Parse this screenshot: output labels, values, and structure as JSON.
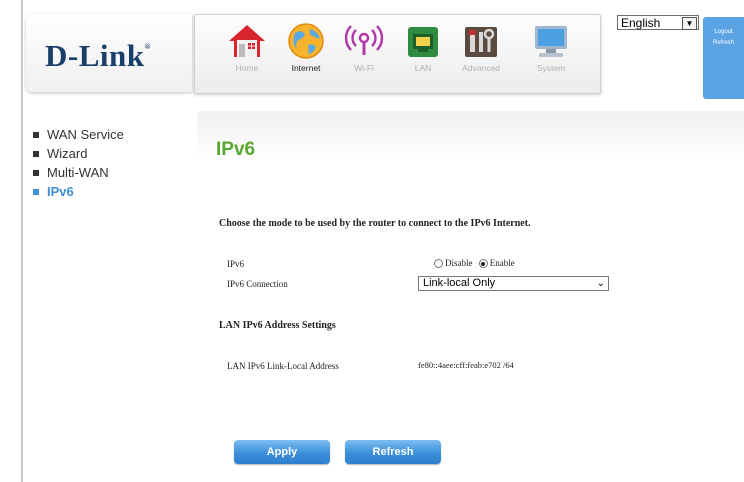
{
  "brand": {
    "logo_text": "D-Link",
    "logo_mark": "®"
  },
  "nav": {
    "items": [
      {
        "label": "Home",
        "icon": "home-icon"
      },
      {
        "label": "Internet",
        "icon": "globe-icon"
      },
      {
        "label": "Wi-Fi",
        "icon": "wifi-icon"
      },
      {
        "label": "LAN",
        "icon": "lan-icon"
      },
      {
        "label": "Advanced",
        "icon": "tools-icon"
      },
      {
        "label": "System",
        "icon": "computer-icon"
      }
    ],
    "active": "Internet"
  },
  "language": {
    "selected": "English"
  },
  "session": {
    "logout_label": "Logout",
    "refresh_label": "Refresh"
  },
  "sidebar": {
    "items": [
      {
        "label": "WAN Service"
      },
      {
        "label": "Wizard"
      },
      {
        "label": "Multi-WAN"
      },
      {
        "label": "IPv6"
      }
    ],
    "active": "IPv6"
  },
  "page": {
    "title": "IPv6",
    "description": "Choose the mode to be used by the router to connect to the IPv6 Internet.",
    "ipv6_label": "IPv6",
    "disable_label": "Disable",
    "enable_label": "Enable",
    "ipv6_state": "Enable",
    "connection_label": "IPv6 Connection",
    "connection_value": "Link-local Only",
    "lan_section_title": "LAN IPv6 Address Settings",
    "link_local_label": "LAN IPv6 Link-Local Address",
    "link_local_value": "fe80::4aee:cff:feab:e702 /64",
    "apply_label": "Apply",
    "refresh_label": "Refresh"
  },
  "colors": {
    "title_green": "#59a832",
    "accent_blue": "#3f8fd6",
    "logo_navy": "#1a3f6b"
  }
}
